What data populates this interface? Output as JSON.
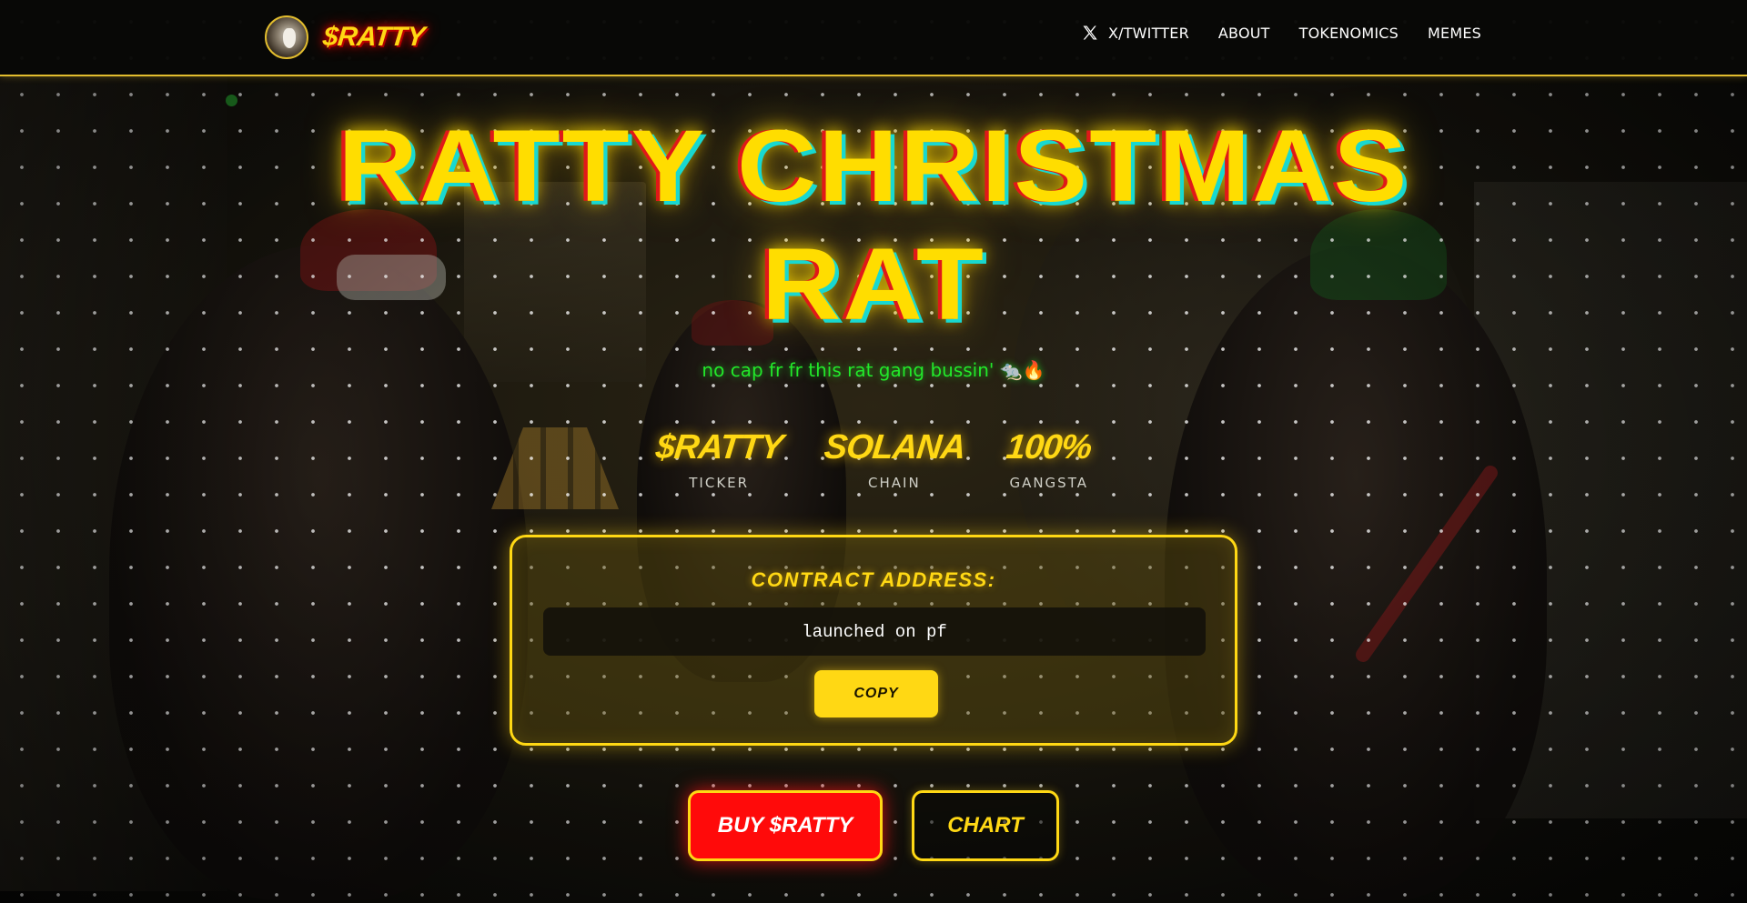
{
  "header": {
    "brand_name": "$RATTY",
    "nav": [
      {
        "label": "X/TWITTER",
        "icon": "x-logo-icon"
      },
      {
        "label": "ABOUT"
      },
      {
        "label": "TOKENOMICS"
      },
      {
        "label": "MEMES"
      }
    ]
  },
  "hero": {
    "title_line1": "RATTY CHRISTMAS",
    "title_line2": "RAT",
    "tagline": "no cap fr fr this rat gang bussin' 🐀🔥"
  },
  "stats": [
    {
      "value": "$RATTY",
      "label": "TICKER"
    },
    {
      "value": "SOLANA",
      "label": "CHAIN"
    },
    {
      "value": "100%",
      "label": "GANGSTA"
    }
  ],
  "contract": {
    "label": "CONTRACT ADDRESS:",
    "value": "launched on pf",
    "copy_label": "COPY"
  },
  "cta": {
    "buy_label": "BUY $RATTY",
    "chart_label": "CHART"
  },
  "colors": {
    "accent_yellow": "#ffd814",
    "buy_red": "#ff0a0a",
    "tagline_green": "#22e82a",
    "background": "#0b0b08"
  }
}
